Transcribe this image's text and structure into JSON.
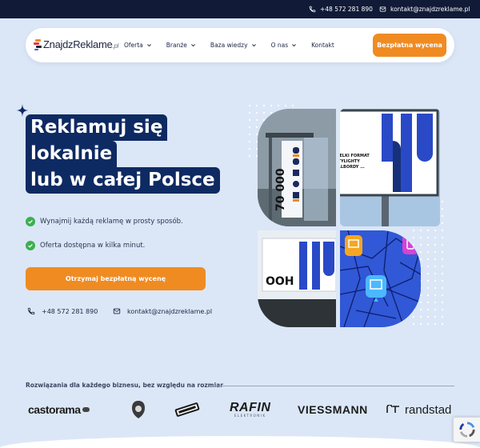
{
  "topbar": {
    "phone": "+48 572 281 890",
    "email": "kontakt@znajdzreklame.pl"
  },
  "nav": {
    "logo_text": "ZnajdzReklame",
    "logo_suffix": ".pl",
    "menu": [
      {
        "label": "Oferta",
        "has_dropdown": true
      },
      {
        "label": "Branże",
        "has_dropdown": true
      },
      {
        "label": "Baza wiedzy",
        "has_dropdown": true
      },
      {
        "label": "O nas",
        "has_dropdown": true
      },
      {
        "label": "Kontakt",
        "has_dropdown": false
      }
    ],
    "cta_label": "Bezpłatna wycena"
  },
  "hero": {
    "headline": [
      "Reklamuj się",
      "lokalnie",
      "lub w całej Polsce"
    ],
    "checks": [
      "Wynajmij każdą reklamę w prosty sposób.",
      "Oferta dostępna w kilka minut."
    ],
    "cta_label": "Otrzymaj bezpłatną wycenę",
    "phone": "+48 572 281 890",
    "email": "kontakt@znajdzreklame.pl"
  },
  "collage": {
    "citylight_text": "70 000",
    "billboard_text": "WIELKI FORMAT CITYLIGHTY BILLBORDY ...",
    "ooh_text": "OOH"
  },
  "clients": {
    "label": "Rozwiązania dla każdego biznesu, bez względu na rozmiar",
    "logos": [
      "castorama",
      "RAFIN",
      "VIESSMANN",
      "randstad"
    ],
    "rafin_tagline": "ELEKTRONIK"
  },
  "colors": {
    "topbar": "#111b38",
    "accent": "#f08b22",
    "headline_bg": "#0e2a62",
    "check": "#3cb04e",
    "page_bg": "#dbe7f7"
  }
}
